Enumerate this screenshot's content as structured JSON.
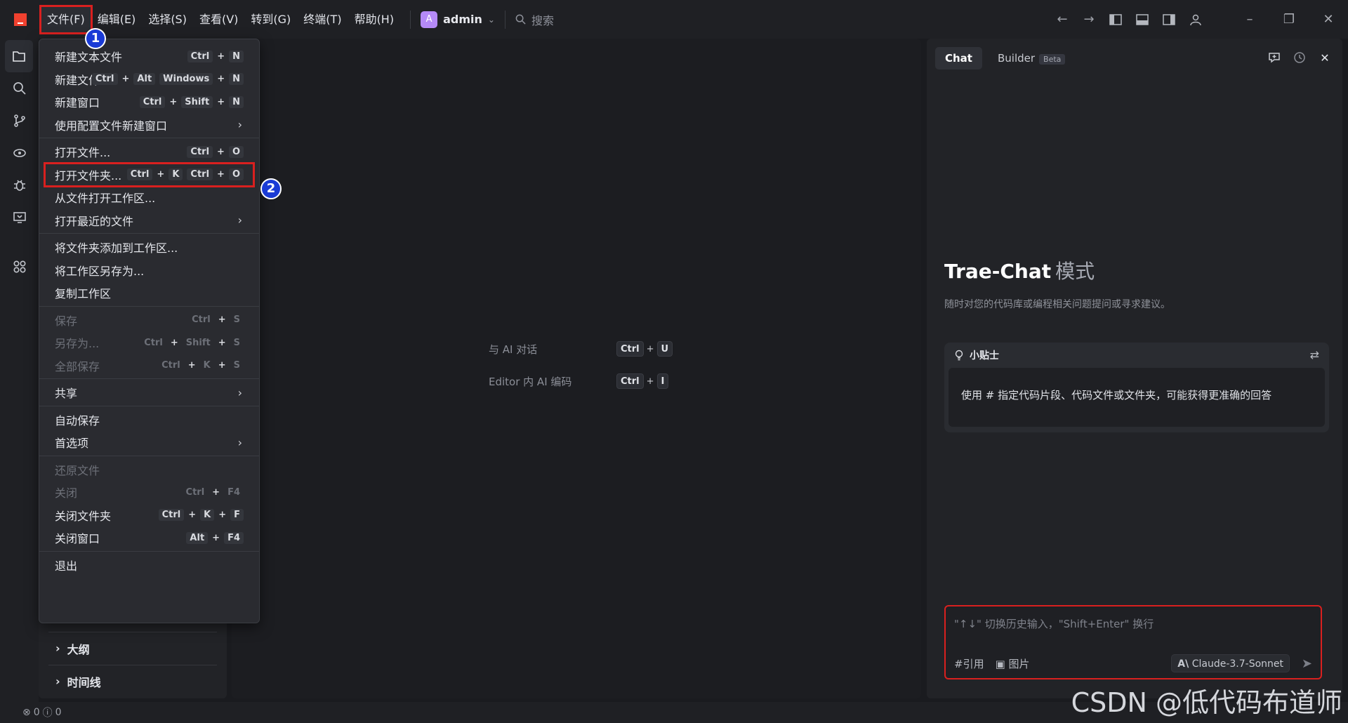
{
  "menubar": {
    "items": [
      "文件(F)",
      "编辑(E)",
      "选择(S)",
      "查看(V)",
      "转到(G)",
      "终端(T)",
      "帮助(H)"
    ]
  },
  "user": {
    "initial": "A",
    "name": "admin"
  },
  "search": {
    "placeholder": "搜索"
  },
  "file_menu": {
    "groups": [
      [
        {
          "label": "新建文本文件",
          "shortcut": [
            "Ctrl",
            "N"
          ]
        },
        {
          "label": "新建文件...",
          "shortcut": [
            "Ctrl",
            "Alt",
            "Windows",
            "N"
          ]
        },
        {
          "label": "新建窗口",
          "shortcut": [
            "Ctrl",
            "Shift",
            "N"
          ]
        },
        {
          "label": "使用配置文件新建窗口",
          "submenu": true
        }
      ],
      [
        {
          "label": "打开文件...",
          "shortcut": [
            "Ctrl",
            "O"
          ]
        },
        {
          "label": "打开文件夹...",
          "shortcut": [
            "Ctrl",
            "K",
            "Ctrl",
            "O"
          ],
          "highlighted": true
        },
        {
          "label": "从文件打开工作区..."
        },
        {
          "label": "打开最近的文件",
          "submenu": true
        }
      ],
      [
        {
          "label": "将文件夹添加到工作区..."
        },
        {
          "label": "将工作区另存为..."
        },
        {
          "label": "复制工作区"
        }
      ],
      [
        {
          "label": "保存",
          "shortcut": [
            "Ctrl",
            "S"
          ],
          "disabled": true
        },
        {
          "label": "另存为...",
          "shortcut": [
            "Ctrl",
            "Shift",
            "S"
          ],
          "disabled": true
        },
        {
          "label": "全部保存",
          "shortcut": [
            "Ctrl",
            "K",
            "S"
          ],
          "disabled": true
        }
      ],
      [
        {
          "label": "共享",
          "submenu": true
        }
      ],
      [
        {
          "label": "自动保存"
        },
        {
          "label": "首选项",
          "submenu": true
        }
      ],
      [
        {
          "label": "还原文件",
          "disabled": true
        },
        {
          "label": "关闭",
          "shortcut": [
            "Ctrl",
            "F4"
          ],
          "disabled": true
        },
        {
          "label": "关闭文件夹",
          "shortcut": [
            "Ctrl",
            "K",
            "F"
          ]
        },
        {
          "label": "关闭窗口",
          "shortcut": [
            "Alt",
            "F4"
          ]
        }
      ],
      [
        {
          "label": "退出"
        }
      ]
    ]
  },
  "callouts": {
    "one": "1",
    "two": "2"
  },
  "sidebar": {
    "outline": "大纲",
    "timeline": "时间线"
  },
  "editor": {
    "hints": [
      {
        "label": "与 AI 对话",
        "keys": [
          "Ctrl",
          "U"
        ]
      },
      {
        "label": "Editor 内 AI 编码",
        "keys": [
          "Ctrl",
          "I"
        ]
      }
    ]
  },
  "chat": {
    "tab_chat": "Chat",
    "tab_builder": "Builder",
    "beta": "Beta",
    "title": "Trae-Chat",
    "title_mode": "模式",
    "description": "随时对您的代码库或编程相关问题提问或寻求建议。",
    "tips_title": "小贴士",
    "tips_body": "使用 # 指定代码片段、代码文件或文件夹，可能获得更准确的回答",
    "input_placeholder": "\"↑↓\" 切换历史输入，\"Shift+Enter\" 换行",
    "reference": "#引用",
    "image": "图片",
    "model": "Claude-3.7-Sonnet"
  },
  "status": {
    "errors": "0",
    "warnings": "0"
  },
  "watermark": "CSDN @低代码布道师",
  "colors": {
    "highlight": "#d9201f",
    "badge": "#1a3bd6",
    "logo": "#f0412f"
  }
}
